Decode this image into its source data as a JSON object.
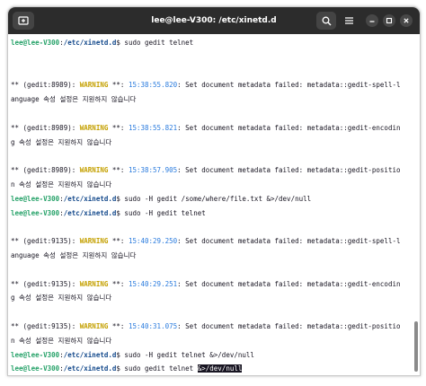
{
  "window": {
    "title": "lee@lee-V300: /etc/xinetd.d"
  },
  "icons": {
    "new_tab": "new-tab-icon",
    "search": "search-icon",
    "menu": "hamburger-menu-icon",
    "minimize": "minimize-icon",
    "maximize": "maximize-icon",
    "close": "close-icon"
  },
  "colors": {
    "prompt_user": "#26a269",
    "prompt_path": "#12488b",
    "warning": "#c4a000",
    "timestamp": "#2a7bde",
    "titlebar": "#2c2c2c"
  },
  "terminal": {
    "lines": [
      [
        {
          "t": "lee@lee-V300",
          "c": "prompt"
        },
        {
          "t": ":"
        },
        {
          "t": "/etc/xinetd.d",
          "c": "path"
        },
        {
          "t": "$ sudo gedit telnet"
        }
      ],
      [
        {
          "t": ""
        }
      ],
      [
        {
          "t": ""
        }
      ],
      [
        {
          "t": "** (gedit:8989): "
        },
        {
          "t": "WARNING",
          "c": "warn"
        },
        {
          "t": " **: "
        },
        {
          "t": "15:38:55.820",
          "c": "time"
        },
        {
          "t": ": Set document metadata failed: metadata::gedit-spell-l"
        }
      ],
      [
        {
          "t": "anguage 속성 설정은 지원하지 않습니다"
        }
      ],
      [
        {
          "t": ""
        }
      ],
      [
        {
          "t": "** (gedit:8989): "
        },
        {
          "t": "WARNING",
          "c": "warn"
        },
        {
          "t": " **: "
        },
        {
          "t": "15:38:55.821",
          "c": "time"
        },
        {
          "t": ": Set document metadata failed: metadata::gedit-encodin"
        }
      ],
      [
        {
          "t": "g 속성 설정은 지원하지 않습니다"
        }
      ],
      [
        {
          "t": ""
        }
      ],
      [
        {
          "t": "** (gedit:8989): "
        },
        {
          "t": "WARNING",
          "c": "warn"
        },
        {
          "t": " **: "
        },
        {
          "t": "15:38:57.905",
          "c": "time"
        },
        {
          "t": ": Set document metadata failed: metadata::gedit-positio"
        }
      ],
      [
        {
          "t": "n 속성 설정은 지원하지 않습니다"
        }
      ],
      [
        {
          "t": "lee@lee-V300",
          "c": "prompt"
        },
        {
          "t": ":"
        },
        {
          "t": "/etc/xinetd.d",
          "c": "path"
        },
        {
          "t": "$ sudo -H gedit /some/where/file.txt &>/dev/null"
        }
      ],
      [
        {
          "t": "lee@lee-V300",
          "c": "prompt"
        },
        {
          "t": ":"
        },
        {
          "t": "/etc/xinetd.d",
          "c": "path"
        },
        {
          "t": "$ sudo -H gedit telnet"
        }
      ],
      [
        {
          "t": ""
        }
      ],
      [
        {
          "t": "** (gedit:9135): "
        },
        {
          "t": "WARNING",
          "c": "warn"
        },
        {
          "t": " **: "
        },
        {
          "t": "15:40:29.250",
          "c": "time"
        },
        {
          "t": ": Set document metadata failed: metadata::gedit-spell-l"
        }
      ],
      [
        {
          "t": "anguage 속성 설정은 지원하지 않습니다"
        }
      ],
      [
        {
          "t": ""
        }
      ],
      [
        {
          "t": "** (gedit:9135): "
        },
        {
          "t": "WARNING",
          "c": "warn"
        },
        {
          "t": " **: "
        },
        {
          "t": "15:40:29.251",
          "c": "time"
        },
        {
          "t": ": Set document metadata failed: metadata::gedit-encodin"
        }
      ],
      [
        {
          "t": "g 속성 설정은 지원하지 않습니다"
        }
      ],
      [
        {
          "t": ""
        }
      ],
      [
        {
          "t": "** (gedit:9135): "
        },
        {
          "t": "WARNING",
          "c": "warn"
        },
        {
          "t": " **: "
        },
        {
          "t": "15:40:31.075",
          "c": "time"
        },
        {
          "t": ": Set document metadata failed: metadata::gedit-positio"
        }
      ],
      [
        {
          "t": "n 속성 설정은 지원하지 않습니다"
        }
      ],
      [
        {
          "t": "lee@lee-V300",
          "c": "prompt"
        },
        {
          "t": ":"
        },
        {
          "t": "/etc/xinetd.d",
          "c": "path"
        },
        {
          "t": "$ sudo -H gedit telnet &>/dev/null"
        }
      ],
      [
        {
          "t": "lee@lee-V300",
          "c": "prompt"
        },
        {
          "t": ":"
        },
        {
          "t": "/etc/xinetd.d",
          "c": "path"
        },
        {
          "t": "$ sudo gedit telnet "
        },
        {
          "t": "&>/dev/null",
          "c": "sel"
        }
      ],
      [
        {
          "t": "lee@lee-V300",
          "c": "prompt"
        },
        {
          "t": ":"
        },
        {
          "t": "/etc/xinetd.d",
          "c": "path"
        },
        {
          "t": "$ "
        },
        {
          "t": "",
          "c": "cursor"
        }
      ]
    ]
  }
}
